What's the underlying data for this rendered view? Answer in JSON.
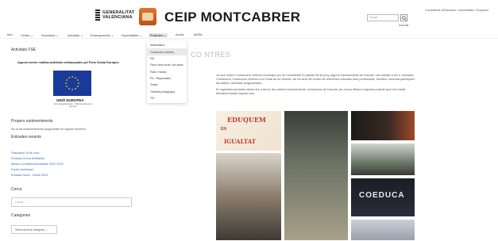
{
  "header": {
    "gov_logo_line1": "GENERALITAT",
    "gov_logo_line2": "VALENCIANA",
    "site_title": "CEIP MONTCABRER",
    "top_links": "Conselleria d'Educació, Universitats i Ocupació",
    "search_placeholder": "Cercar",
    "access_link": "Accedir"
  },
  "nav": {
    "items": [
      {
        "label": "Inici"
      },
      {
        "label": "Centre ⌄"
      },
      {
        "label": "Secretaria ⌄"
      },
      {
        "label": "Activitats ⌄"
      },
      {
        "label": "Ensenyaments ⌄"
      },
      {
        "label": "Especialitats ⌄"
      },
      {
        "label": "Projectes ⌄"
      },
      {
        "label": "Arxius"
      },
      {
        "label": "AMPA"
      }
    ]
  },
  "dropdown": {
    "items": [
      {
        "label": "Matemàtica"
      },
      {
        "label": "Coeduca'm centres"
      },
      {
        "label": "PIE"
      },
      {
        "label": "Parcs dels socis i les aules"
      },
      {
        "label": "Patis i Hàbits"
      },
      {
        "label": "PIL i Riquesaltes"
      },
      {
        "label": "Teatre"
      },
      {
        "label": "Treballs pedagògics"
      },
      {
        "label": "TEI"
      }
    ]
  },
  "sidebar": {
    "fse_heading": "Activitats FSE",
    "fse_text": "Aquest centre realitza activitats cofinançades pel Fons Social Europeu",
    "eu_label": "UNIÓ EUROPEA",
    "eu_sub": "Fons Social Europeu · FSE inverteix en el teu futur",
    "upcoming_heading": "Propers esdeveniments",
    "upcoming_text": "No hi ha esdeveniments programats en aquest moment.",
    "recent_heading": "Entrades recents",
    "recent_links": [
      "Graduació 5t de curs",
      "Podcast Cerca (Refiable)",
      "Mostra Jornades/Modalitats 2022-2023",
      "Fonts d'admissió",
      "Entrada Nova - Ciutat 2024"
    ],
    "search_heading": "Cerca",
    "search_placeholder": "Cerca ...",
    "categories_heading": "Categories",
    "categories_select": "Selecciona la categoria ⌄"
  },
  "main": {
    "page_title": "CO        NTRES",
    "para1": "Ja som centre Coeduca'm centres reconegut per la Conselleria! El passat 28 de juny, alguns representants de l'escola, van assistir a les II Jornades Coeduca'm Coeduca'm centres a la Ciutat de la Ciència i de les Arts del centre de referència educatiu amb professorat, famílies i alumnat participant als tallers i activitats programades.",
    "para2": "En aquestes jornades vàrem dur a terme les nostres coneixements i actuacions de l'escola, per donar difusió d'aquest projecte que hem estat treballant durant aquest curs.",
    "photo1_line1": "EDUQUEM",
    "photo1_line2": "EN",
    "photo1_line3": "IGUALTAT",
    "photo6_text": "COEDUCA"
  },
  "colors": {
    "link": "#3b6fb5",
    "eu_blue": "#1a3a9a",
    "eu_star": "#f7d117",
    "accent_red": "#c03a2b"
  }
}
